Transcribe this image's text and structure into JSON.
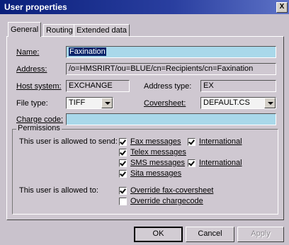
{
  "window": {
    "title": "User properties",
    "close_symbol": "X"
  },
  "tabs": [
    {
      "label": "General",
      "active": true
    },
    {
      "label": "Routing",
      "active": false
    },
    {
      "label": "Extended data",
      "active": false
    }
  ],
  "general": {
    "name_label": "Name:",
    "name_value": "Faxination",
    "address_label": "Address:",
    "address_value": "/o=HMSRIRT/ou=BLUE/cn=Recipients/cn=Faxination",
    "host_label": "Host system:",
    "host_value": "EXCHANGE",
    "address_type_label": "Address type:",
    "address_type_value": "EX",
    "file_type_label": "File type:",
    "file_type_value": "TIFF",
    "coversheet_label": "Coversheet:",
    "coversheet_value": "DEFAULT.CS",
    "charge_code_label": "Charge code:",
    "charge_code_value": ""
  },
  "permissions": {
    "title": "Permissions",
    "send_label": "This user is allowed to send:",
    "allowed_label": "This user is allowed to:",
    "items": [
      {
        "label": "Fax messages",
        "checked": true
      },
      {
        "label": "International",
        "checked": true
      },
      {
        "label": "Telex messages",
        "checked": true
      },
      {
        "label": "SMS messages",
        "checked": true
      },
      {
        "label": "International",
        "checked": true
      },
      {
        "label": "Sita messages",
        "checked": true
      },
      {
        "label": "Override fax-coversheet",
        "checked": true
      },
      {
        "label": "Override chargecode",
        "checked": false
      }
    ]
  },
  "buttons": {
    "ok": "OK",
    "cancel": "Cancel",
    "apply": "Apply"
  }
}
